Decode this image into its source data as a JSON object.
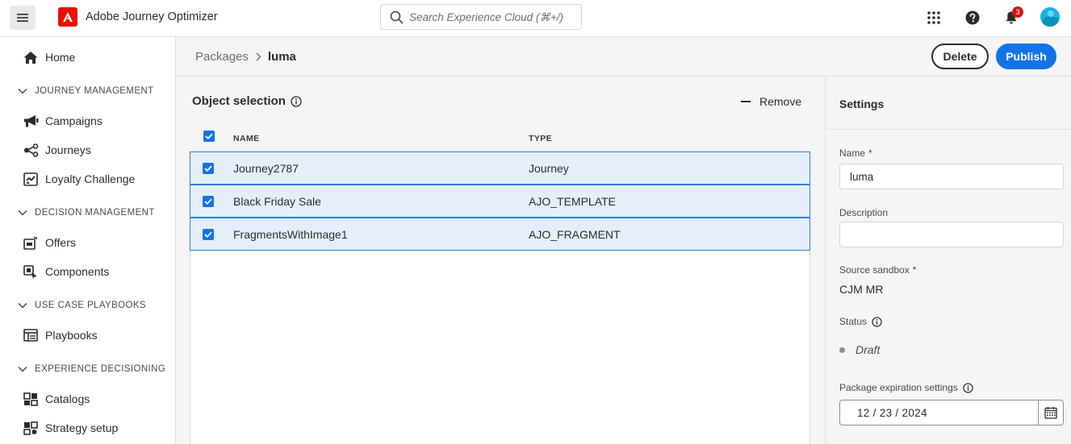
{
  "topbar": {
    "app_title": "Adobe Journey Optimizer",
    "search_placeholder": "Search Experience Cloud (⌘+/)",
    "notification_count": "3",
    "brand_color": "#eb1000",
    "icons": [
      "menu-icon",
      "adobe-logo",
      "search-icon",
      "apps-grid-icon",
      "help-icon",
      "bell-icon",
      "avatar"
    ]
  },
  "sidebar": {
    "home": "Home",
    "sections": [
      {
        "title": "JOURNEY MANAGEMENT",
        "items": [
          "Campaigns",
          "Journeys",
          "Loyalty Challenge"
        ]
      },
      {
        "title": "DECISION MANAGEMENT",
        "items": [
          "Offers",
          "Components"
        ]
      },
      {
        "title": "USE CASE PLAYBOOKS",
        "items": [
          "Playbooks"
        ]
      },
      {
        "title": "EXPERIENCE DECISIONING",
        "items": [
          "Catalogs",
          "Strategy setup"
        ]
      }
    ]
  },
  "header": {
    "breadcrumb_parent": "Packages",
    "breadcrumb_current": "luma",
    "delete_label": "Delete",
    "publish_label": "Publish",
    "accent_color": "#1473e6"
  },
  "selection": {
    "title": "Object selection",
    "remove_label": "Remove",
    "columns": {
      "name": "NAME",
      "type": "TYPE"
    },
    "rows": [
      {
        "name": "Journey2787",
        "type": "Journey",
        "checked": true
      },
      {
        "name": "Black Friday Sale",
        "type": "AJO_TEMPLATE",
        "checked": true
      },
      {
        "name": "FragmentsWithImage1",
        "type": "AJO_FRAGMENT",
        "checked": true
      }
    ]
  },
  "settings": {
    "title": "Settings",
    "name_label": "Name",
    "name_value": "luma",
    "description_label": "Description",
    "description_value": "",
    "source_sandbox_label": "Source sandbox",
    "source_sandbox_value": "CJM MR",
    "status_label": "Status",
    "status_value": "Draft",
    "expiration_label": "Package expiration settings",
    "expiration_date": "12 / 23 / 2024",
    "required_mark": "*"
  }
}
